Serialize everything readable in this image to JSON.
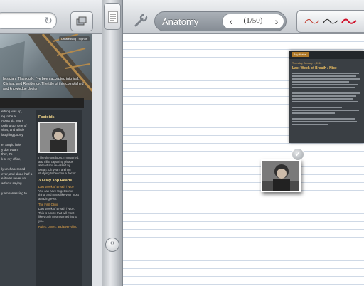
{
  "browser": {
    "blog_links": "Create Blog · Sign In",
    "post_intro": "hysician. Thankfully, I've been accepted into ical, Clinical, and Residency. The title of this complished and knowledge doctor.",
    "post_body": [
      "ething was up,",
      "ng to be a",
      "About six hours",
      "ooking up. One of",
      "vkes, and a little",
      "laughing poorly",
      "e. Stupid little",
      "y don't want",
      "ther, it's",
      "k to my office,",
      "ly unchaperoned",
      "ever, and about half a",
      "e it was never an",
      "without saying",
      "y embarrassing to"
    ],
    "sidebar_title_1": "Factoids",
    "sidebar_bio": "I like the outdoors. I'm married, and I like capturing photos abroad and re-visited by ocean. Oh yeah, and I'm studying to become a doctor.",
    "sidebar_title_2": "30-Day Top Reads",
    "sidebar_link_1": "Last Week of Breath / Nice",
    "sidebar_text_2": "You can have to get some thing, and notes like your most amazing ever.",
    "sidebar_link_2": "The First Clinic",
    "sidebar_text_3": "Last Week of Breath / Nice. This is a note that will most likely only mean something to you.",
    "sidebar_link_3": "Rules, Lunes, and Everything"
  },
  "notebook": {
    "name": "Anatomy",
    "page_indicator": "(1/50)",
    "prev_glyph": "‹",
    "next_glyph": "›"
  },
  "pasted_post": {
    "tag": "My Notes",
    "date": "Thursday, January 1, 2010",
    "title": "Last Week of Breath / Nice"
  },
  "colors": {
    "pen_1": "#c0392b",
    "pen_2": "#333333",
    "pen_3": "#d0102a",
    "margin_line": "#e37a7a"
  },
  "icons": [
    "reload-icon",
    "tabs-icon",
    "notes-toggle-icon",
    "wrench-icon",
    "check-icon"
  ]
}
